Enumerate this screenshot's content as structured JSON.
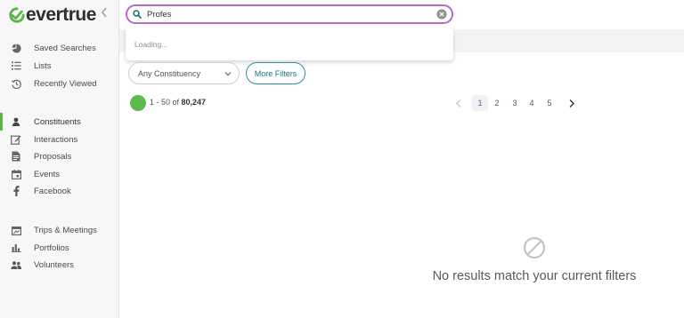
{
  "brand": {
    "name": "evertrue",
    "accent": "#59b44a",
    "purple": "#b26bcf"
  },
  "sidebar": {
    "collapse_icon": "chevron-left-icon",
    "items": [
      {
        "label": "Saved Searches",
        "icon": "pie-chart-icon",
        "active": false
      },
      {
        "label": "Lists",
        "icon": "list-icon",
        "active": false
      },
      {
        "label": "Recently Viewed",
        "icon": "history-icon",
        "active": false
      },
      {
        "label": "Constituents",
        "icon": "person-icon",
        "active": true
      },
      {
        "label": "Interactions",
        "icon": "edit-icon",
        "active": false
      },
      {
        "label": "Proposals",
        "icon": "document-icon",
        "active": false
      },
      {
        "label": "Events",
        "icon": "calendar-icon",
        "active": false
      },
      {
        "label": "Facebook",
        "icon": "facebook-icon",
        "active": false
      },
      {
        "label": "Trips & Meetings",
        "icon": "trips-icon",
        "active": false
      },
      {
        "label": "Portfolios",
        "icon": "bar-chart-icon",
        "active": false
      },
      {
        "label": "Volunteers",
        "icon": "group-icon",
        "active": false
      }
    ]
  },
  "search": {
    "value": "Profes",
    "dropdown_status": "Loading..."
  },
  "filters": {
    "constituency_value": "Any Constituency",
    "more_filters_label": "More Filters"
  },
  "results": {
    "range": "1 - 50 of ",
    "total": "80,247"
  },
  "pagination": {
    "pages": [
      "1",
      "2",
      "3",
      "4",
      "5"
    ],
    "current": "1",
    "prev_symbol": "‹",
    "next_symbol": "›"
  },
  "empty_state": {
    "icon": "prohibited-icon",
    "message": "No results match your current filters"
  }
}
